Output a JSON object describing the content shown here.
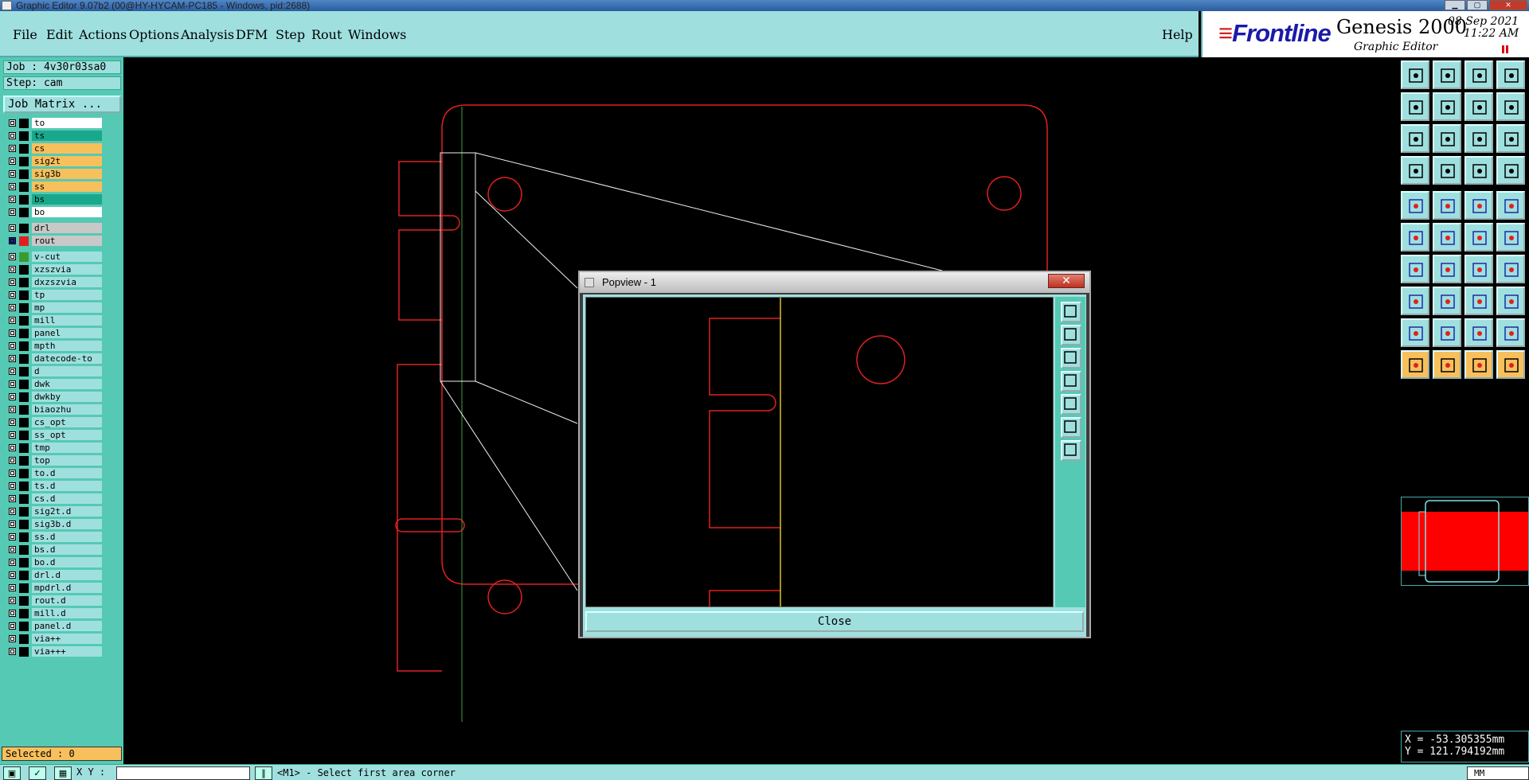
{
  "window": {
    "title": "Graphic Editor 9.07b2 (00@HY-HYCAM-PC185 - Windows, pid:2688)",
    "min": "▁",
    "max": "▢",
    "close": "✕"
  },
  "menu": {
    "items": [
      "File",
      "Edit",
      "Actions",
      "Options",
      "Analysis",
      "DFM",
      "Step",
      "Rout",
      "Windows"
    ],
    "help": "Help"
  },
  "brand": {
    "logo": "Frontline",
    "product": "Genesis 2000",
    "subtitle": "Graphic Editor",
    "date": "08 Sep 2021",
    "time": "11:22  AM"
  },
  "left": {
    "job": "Job : 4v30r03sa0",
    "step": "Step: cam",
    "job_matrix": "Job Matrix ...",
    "selected": "Selected : 0"
  },
  "layers": [
    {
      "name": "to",
      "bg": "#ffffff",
      "swatch": "#000000"
    },
    {
      "name": "ts",
      "bg": "#1aa88c",
      "swatch": "#000000"
    },
    {
      "name": "cs",
      "bg": "#f7c05c",
      "swatch": "#000000"
    },
    {
      "name": "sig2t",
      "bg": "#f7c05c",
      "swatch": "#000000"
    },
    {
      "name": "sig3b",
      "bg": "#f7c05c",
      "swatch": "#000000"
    },
    {
      "name": "ss",
      "bg": "#f7c05c",
      "swatch": "#000000"
    },
    {
      "name": "bs",
      "bg": "#1aa88c",
      "swatch": "#000000"
    },
    {
      "name": "bo",
      "bg": "#ffffff",
      "swatch": "#000000"
    },
    {
      "name": "drl",
      "bg": "#c8c8c8",
      "swatch": "#000000",
      "gap": true
    },
    {
      "name": "rout",
      "bg": "#c8c8c8",
      "swatch": "#e02020",
      "active": true
    },
    {
      "name": "v-cut",
      "bg": "#9fe0df",
      "swatch": "#3a9a30",
      "gap": true
    },
    {
      "name": "xzszvia",
      "bg": "#9fe0df",
      "swatch": "#000000"
    },
    {
      "name": "dxzszvia",
      "bg": "#9fe0df",
      "swatch": "#000000"
    },
    {
      "name": "tp",
      "bg": "#9fe0df",
      "swatch": "#000000"
    },
    {
      "name": "mp",
      "bg": "#9fe0df",
      "swatch": "#000000"
    },
    {
      "name": "mill",
      "bg": "#9fe0df",
      "swatch": "#000000"
    },
    {
      "name": "panel",
      "bg": "#9fe0df",
      "swatch": "#000000"
    },
    {
      "name": "mpth",
      "bg": "#9fe0df",
      "swatch": "#000000"
    },
    {
      "name": "datecode-to",
      "bg": "#9fe0df",
      "swatch": "#000000"
    },
    {
      "name": "d",
      "bg": "#9fe0df",
      "swatch": "#000000"
    },
    {
      "name": "dwk",
      "bg": "#9fe0df",
      "swatch": "#000000"
    },
    {
      "name": "dwkby",
      "bg": "#9fe0df",
      "swatch": "#000000"
    },
    {
      "name": "biaozhu",
      "bg": "#9fe0df",
      "swatch": "#000000"
    },
    {
      "name": "cs_opt",
      "bg": "#9fe0df",
      "swatch": "#000000"
    },
    {
      "name": "ss_opt",
      "bg": "#9fe0df",
      "swatch": "#000000"
    },
    {
      "name": "tmp",
      "bg": "#9fe0df",
      "swatch": "#000000"
    },
    {
      "name": "top",
      "bg": "#9fe0df",
      "swatch": "#000000"
    },
    {
      "name": "to.d",
      "bg": "#9fe0df",
      "swatch": "#000000"
    },
    {
      "name": "ts.d",
      "bg": "#9fe0df",
      "swatch": "#000000"
    },
    {
      "name": "cs.d",
      "bg": "#9fe0df",
      "swatch": "#000000"
    },
    {
      "name": "sig2t.d",
      "bg": "#9fe0df",
      "swatch": "#000000"
    },
    {
      "name": "sig3b.d",
      "bg": "#9fe0df",
      "swatch": "#000000"
    },
    {
      "name": "ss.d",
      "bg": "#9fe0df",
      "swatch": "#000000"
    },
    {
      "name": "bs.d",
      "bg": "#9fe0df",
      "swatch": "#000000"
    },
    {
      "name": "bo.d",
      "bg": "#9fe0df",
      "swatch": "#000000"
    },
    {
      "name": "drl.d",
      "bg": "#9fe0df",
      "swatch": "#000000"
    },
    {
      "name": "mpdrl.d",
      "bg": "#9fe0df",
      "swatch": "#000000"
    },
    {
      "name": "rout.d",
      "bg": "#9fe0df",
      "swatch": "#000000"
    },
    {
      "name": "mill.d",
      "bg": "#9fe0df",
      "swatch": "#000000"
    },
    {
      "name": "panel.d",
      "bg": "#9fe0df",
      "swatch": "#000000"
    },
    {
      "name": "via++",
      "bg": "#9fe0df",
      "swatch": "#000000"
    },
    {
      "name": "via+++",
      "bg": "#9fe0df",
      "swatch": "#000000"
    }
  ],
  "toolbar_icons": [
    "zoom-home-icon",
    "zoom-in-icon",
    "home-icon",
    "grid-icon",
    "pan-left-icon",
    "pan-right-icon",
    "redraw-icon",
    "split-icon",
    "fit-icon",
    "zoom-area-icon",
    "ratio-icon",
    "help-icon",
    "snap-icon",
    "grid-toggle-icon",
    "layers-red-icon",
    "layers-red-2-icon",
    "pad-icon",
    "polygon-icon",
    "measure-icon",
    "dot-icon",
    "node-icon",
    "cross-icon",
    "line-add-icon",
    "line-add-2-icon",
    "slope-icon",
    "line-edit-icon",
    "arc-icon",
    "text-icon",
    "move-icon",
    "minus-icon",
    "box-icon",
    "copy-icon",
    "triangle-icon",
    "triangle-2-icon",
    "triangle-3-icon",
    "triangle-4-icon",
    "select-icon",
    "select-2-icon",
    "select-3-icon",
    "select-4-icon"
  ],
  "coords": {
    "x": "X = -53.305355mm",
    "y": "Y = 121.794192mm"
  },
  "status": {
    "xy_label": "X Y :",
    "prompt": "<M1> - Select first area corner",
    "units": "MM"
  },
  "popview": {
    "title": "Popview - 1",
    "close_x": "✕",
    "close_button": "Close",
    "tool_icons": [
      "fit-icon",
      "zoom-home-icon",
      "zoom-in-icon",
      "pan-left-icon",
      "pan-right-icon",
      "zoom-area-icon",
      "fit-2-icon"
    ]
  },
  "colors": {
    "panel": "#9fe0df",
    "accent": "#55c9b4",
    "outline": "#e02020",
    "vcut": "#e0c020"
  }
}
